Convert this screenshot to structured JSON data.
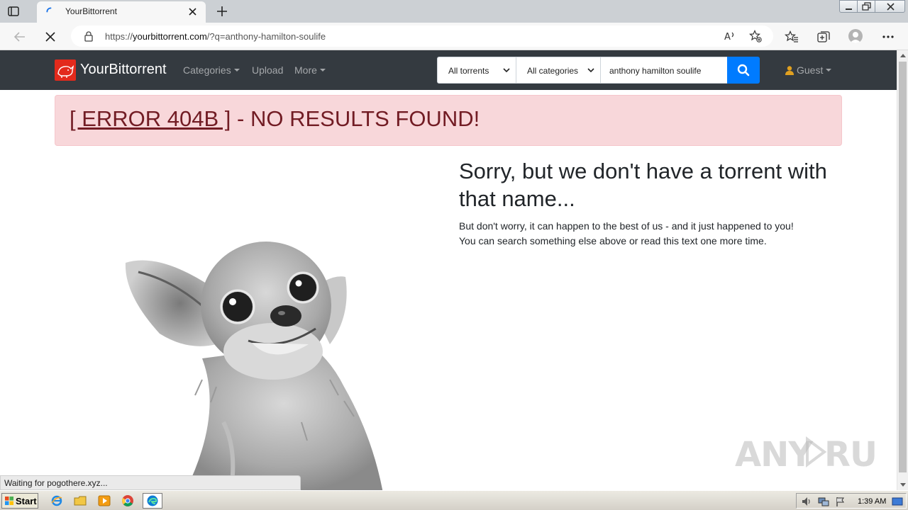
{
  "browser": {
    "tab_title": "YourBittorrent",
    "url_prefix": "https://",
    "url_domain": "yourbittorrent.com",
    "url_path": "/?q=anthony-hamilton-soulife",
    "icons": [
      "tab-actions-icon",
      "loading-spinner-icon",
      "close-icon",
      "new-tab-icon",
      "back-icon",
      "stop-loading-icon",
      "lock-icon",
      "read-aloud-icon",
      "add-favorite-icon",
      "favorites-icon",
      "collections-icon",
      "profile-icon",
      "more-options-icon",
      "minimize-icon",
      "restore-icon",
      "window-close-icon"
    ],
    "status_text": "Waiting for pogothere.xyz..."
  },
  "site": {
    "brand": "YourBittorrent",
    "nav": {
      "categories": "Categories",
      "upload": "Upload",
      "more": "More"
    },
    "search": {
      "type_select": "All torrents",
      "category_select": "All categories",
      "query": "anthony hamilton soulife"
    },
    "user": "Guest"
  },
  "content": {
    "alert_link": "[ ERROR 404B ]",
    "alert_rest": " - NO RESULTS FOUND!",
    "heading": "Sorry, but we don't have a torrent with that name...",
    "line1": "But don't worry, it can happen to the best of us - and it just happened to you!",
    "line2": "You can search something else above or read this text one more time."
  },
  "watermark": "ANY RUN",
  "taskbar": {
    "start_label": "Start",
    "apps": [
      "ie-icon",
      "explorer-icon",
      "media-player-icon",
      "chrome-icon",
      "edge-icon"
    ],
    "clock": "1:39 AM"
  },
  "colors": {
    "navbar": "#343a40",
    "alert_bg": "#f8d7da",
    "alert_text": "#721c24",
    "search_button": "#007bff",
    "brand_logo": "#e32a1c"
  }
}
